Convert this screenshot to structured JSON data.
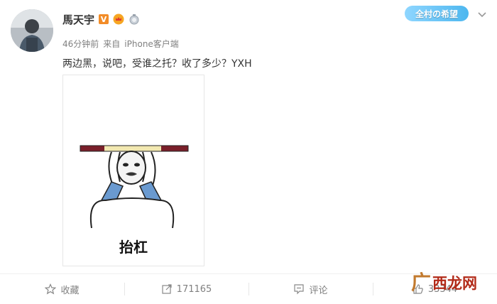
{
  "user": {
    "name": "馬天宇",
    "verified_badge": "V",
    "avatar_icon": "avatar-photo"
  },
  "meta": {
    "time": "46分钟前",
    "source_prefix": "来自",
    "source": "iPhone客户端"
  },
  "post": {
    "text": "两边黑，说吧，受谁之托？收了多少？YXH"
  },
  "banner": {
    "text": "全村の希望"
  },
  "image": {
    "caption": "抬杠"
  },
  "actions": {
    "favorite_label": "收藏",
    "repost_count": "171165",
    "comment_label": "评论",
    "like_count": "33344"
  },
  "watermark": {
    "leaf": "广",
    "text": "西龙网"
  },
  "colors": {
    "text": "#333333",
    "meta": "#808080",
    "verified": "#f28c28",
    "watermark": "#b22a18"
  }
}
